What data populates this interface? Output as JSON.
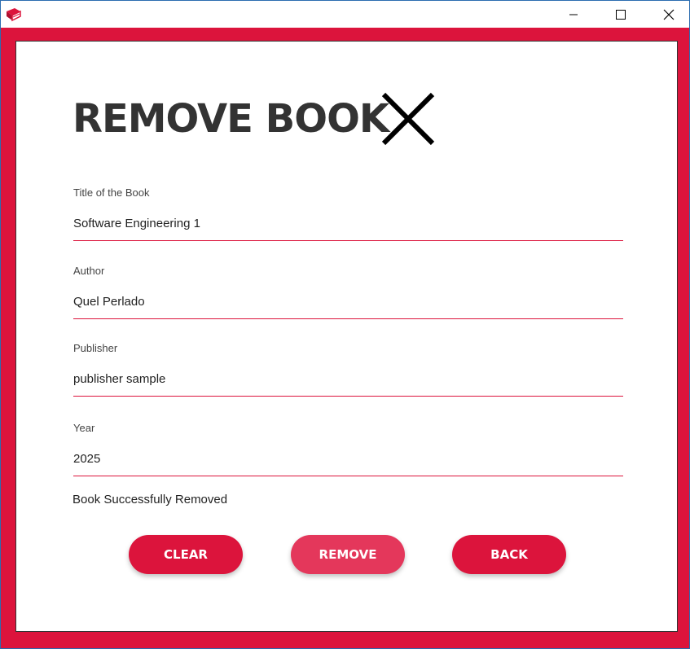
{
  "window": {
    "controls": {
      "minimize": "minimize-icon",
      "maximize": "maximize-icon",
      "close": "close-icon"
    },
    "app_icon": "book-icon"
  },
  "form": {
    "heading": "REMOVE BOOK",
    "heading_icon": "x-icon",
    "fields": [
      {
        "label": "Title of the Book",
        "value": "Software Engineering 1"
      },
      {
        "label": "Author",
        "value": "Quel Perlado"
      },
      {
        "label": "Publisher",
        "value": "publisher sample"
      },
      {
        "label": "Year",
        "value": "2025"
      }
    ],
    "status_message": "Book Successfully Removed"
  },
  "buttons": {
    "clear": "CLEAR",
    "remove": "REMOVE",
    "back": "BACK"
  },
  "colors": {
    "accent": "#dc143c",
    "accent_hover": "#e4375b",
    "heading": "#333333"
  }
}
